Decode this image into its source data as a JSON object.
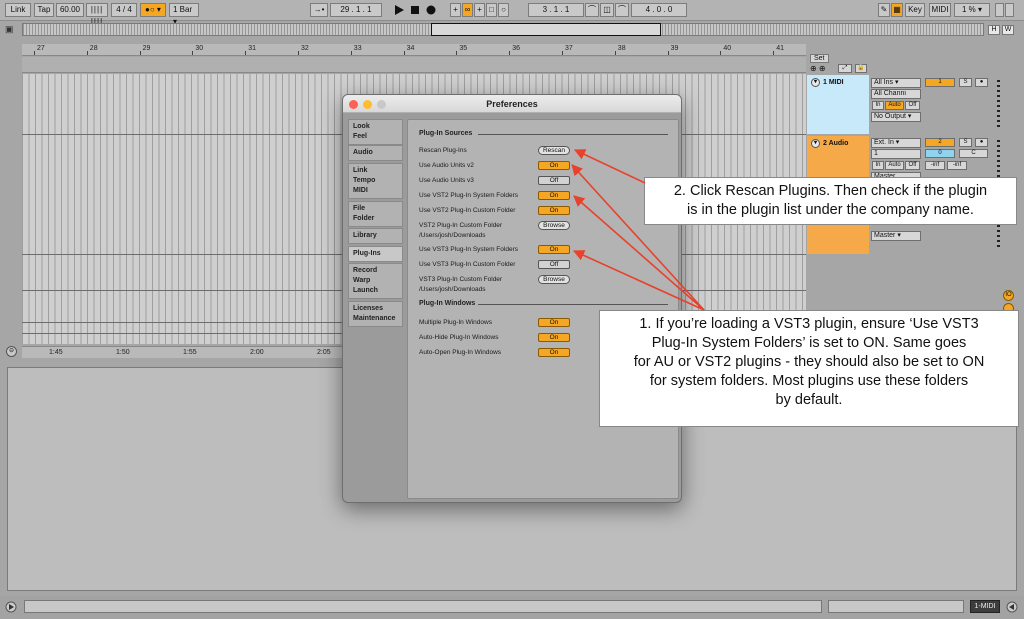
{
  "topbar": {
    "link": "Link",
    "tap": "Tap",
    "tempo": "60.00",
    "signature": "4 / 4",
    "quantize": "1 Bar",
    "position": "29 .  1 .  1",
    "loop_start": "3 .  1 .  1",
    "loop_length": "4 .  0 .  0",
    "key": "Key",
    "midi": "MIDI",
    "cpu": "1 %"
  },
  "overview": {
    "h_button": "H",
    "w_button": "W"
  },
  "ruler": {
    "bars": [
      "27",
      "28",
      "29",
      "30",
      "31",
      "32",
      "33",
      "34",
      "35",
      "36",
      "37",
      "38",
      "39",
      "40",
      "41"
    ]
  },
  "timebar": {
    "times": [
      "1:45",
      "1:50",
      "1:55",
      "2:00",
      "2:05"
    ]
  },
  "tracks": {
    "set_label": "Set",
    "midi_track": {
      "name": "1 MIDI",
      "input": "All Ins",
      "channel": "All Channi",
      "mon_in": "In",
      "mon_auto": "Auto",
      "mon_off": "Off",
      "output": "No Output",
      "number": "1",
      "solo": "S",
      "color": "#c7e9f9"
    },
    "audio_track": {
      "name": "2 Audio",
      "input": "Ext. In",
      "input_channel": "1",
      "mon_in": "In",
      "mon_auto": "Auto",
      "mon_off": "Off",
      "output": "Master",
      "output2": "Master",
      "number": "2",
      "solo": "S",
      "volume": "0",
      "pan": "C",
      "meter_l": "-inf",
      "meter_r": "-inf",
      "color": "#f5a948"
    }
  },
  "status": {
    "midi_label": "1-MIDI"
  },
  "preferences": {
    "title": "Preferences",
    "tabs": [
      {
        "lines": [
          "Look",
          "Feel"
        ]
      },
      {
        "lines": [
          "Audio"
        ]
      },
      {
        "lines": [
          "Link",
          "Tempo",
          "MIDI"
        ]
      },
      {
        "lines": [
          "File",
          "Folder"
        ]
      },
      {
        "lines": [
          "Library"
        ]
      },
      {
        "lines": [
          "Plug-Ins"
        ]
      },
      {
        "lines": [
          "Record",
          "Warp",
          "Launch"
        ]
      },
      {
        "lines": [
          "Licenses",
          "Maintenance"
        ]
      }
    ],
    "plugin_sources_title": "Plug-In Sources",
    "rescan_label": "Rescan Plug-Ins",
    "rescan_button": "Rescan",
    "au_v2_label": "Use Audio Units v2",
    "au_v2_value": "On",
    "au_v3_label": "Use Audio Units v3",
    "au_v3_value": "Off",
    "vst2_system_label": "Use VST2 Plug-In System Folders",
    "vst2_system_value": "On",
    "vst2_custom_label": "Use VST2 Plug-In Custom Folder",
    "vst2_custom_value": "On",
    "vst2_folder_label": "VST2 Plug-In Custom Folder",
    "vst2_folder_path": "/Users/josh/Downloads",
    "browse_button": "Browse",
    "vst3_system_label": "Use VST3 Plug-In System Folders",
    "vst3_system_value": "On",
    "vst3_custom_label": "Use VST3 Plug-In Custom Folder",
    "vst3_custom_value": "Off",
    "vst3_folder_label": "VST3 Plug-In Custom Folder",
    "vst3_folder_path": "/Users/josh/Downloads",
    "browse_button2": "Browse",
    "plugin_windows_title": "Plug-In Windows",
    "multiple_label": "Multiple Plug-In Windows",
    "multiple_value": "On",
    "autohide_label": "Auto-Hide Plug-In Windows",
    "autohide_value": "On",
    "autoopen_label": "Auto-Open Plug-In Windows",
    "autoopen_value": "On"
  },
  "annotations": {
    "note2": [
      "2. Click Rescan Plugins. Then check if the plugin",
      "is in the plugin list under the company name."
    ],
    "note1": [
      "1. If you’re loading a VST3 plugin, ensure ‘Use VST3",
      "Plug-In System Folders’ is set to ON. Same goes",
      "for AU or VST2 plugins - they should also be set to ON",
      "for system folders. Most plugins use these folders",
      "by default."
    ],
    "arrow_color": "#e8412c"
  },
  "colors": {
    "accent_orange": "#f5a623",
    "midi_track_blue": "#c7e9f9",
    "audio_track_orange": "#f5a948"
  }
}
